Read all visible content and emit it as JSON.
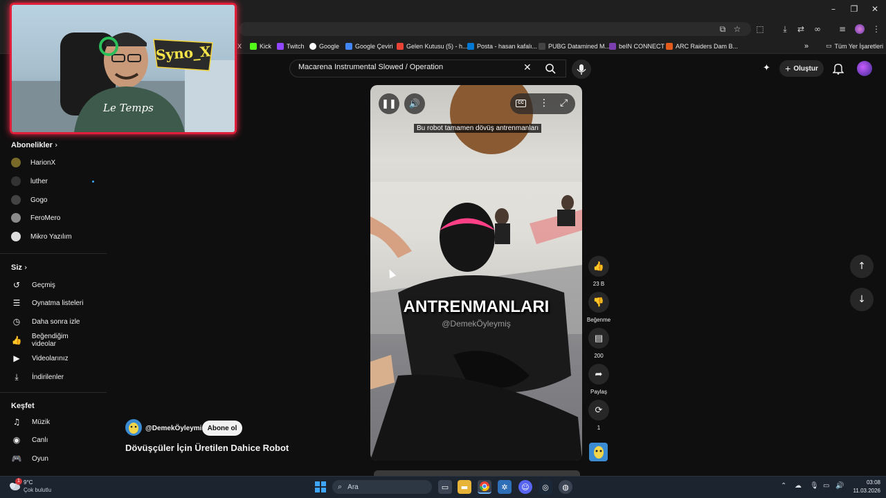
{
  "bookmarks": [
    {
      "label": "X",
      "color": "#000000"
    },
    {
      "label": "Kick",
      "color": "#53fc18"
    },
    {
      "label": "Twitch",
      "color": "#9146ff"
    },
    {
      "label": "Google",
      "color": "#4285f4"
    },
    {
      "label": "Google Çeviri",
      "color": "#4285f4"
    },
    {
      "label": "Gelen Kutusu (5) - h...",
      "color": "#ea4335"
    },
    {
      "label": "Posta - hasan kafalı...",
      "color": "#0078d4"
    },
    {
      "label": "PUBG Datamined M...",
      "color": "#333333"
    },
    {
      "label": "beIN CONNECT",
      "color": "#5b2a86"
    },
    {
      "label": "ARC Raiders Dam B...",
      "color": "#e25a1c"
    }
  ],
  "bookmarks_all": "Tüm Yer İşaretleri",
  "search": {
    "query": "Macarena Instrumental Slowed / Operation"
  },
  "header": {
    "create_label": "Oluştur"
  },
  "webcam": {
    "sign_text": "Syno_X",
    "shirt_text": "Le Temps"
  },
  "sidebar": {
    "subscriptions_title": "Abonelikler",
    "subscriptions": [
      {
        "name": "HarionX",
        "color": "#7a6a2a"
      },
      {
        "name": "luther",
        "color": "#333333"
      },
      {
        "name": "Gogo",
        "color": "#444444"
      },
      {
        "name": "FeroMero",
        "color": "#8a8a8a"
      },
      {
        "name": "Mikro Yazılım",
        "color": "#dddddd"
      }
    ],
    "you_title": "Siz",
    "you_items": [
      {
        "label": "Geçmiş",
        "icon": "history-icon",
        "glyph": "↺"
      },
      {
        "label": "Oynatma listeleri",
        "icon": "playlist-icon",
        "glyph": "☰"
      },
      {
        "label": "Daha sonra izle",
        "icon": "clock-icon",
        "glyph": "◷"
      },
      {
        "label": "Beğendiğim videolar",
        "icon": "thumbs-up-icon",
        "glyph": "👍"
      },
      {
        "label": "Videolarınız",
        "icon": "video-icon",
        "glyph": "▶"
      },
      {
        "label": "İndirilenler",
        "icon": "download-icon",
        "glyph": "⤓"
      }
    ],
    "explore_title": "Keşfet",
    "explore_items": [
      {
        "label": "Müzik",
        "icon": "music-icon",
        "glyph": "♫"
      },
      {
        "label": "Canlı",
        "icon": "live-icon",
        "glyph": "◉"
      },
      {
        "label": "Oyun",
        "icon": "gaming-icon",
        "glyph": "🎮"
      }
    ]
  },
  "video": {
    "caption_top": "Bu robot tamamen dövüş antrenmanları",
    "big_caption": "ANTRENMANLARI",
    "watermark": "@DemekÖyleymiş",
    "channel_name": "@DemekÖyleymiş",
    "subscribe_label": "Abone ol",
    "title": "Dövüşçüler İçin Üretilen Dahice Robot"
  },
  "actions": {
    "likes": "23 B",
    "dislike_label": "Beğenme",
    "comments": "200",
    "share_label": "Paylaş",
    "remix_count": "1"
  },
  "taskbar": {
    "weather_temp": "9°C",
    "weather_desc": "Çok bulutlu",
    "weather_badge": "1",
    "search_placeholder": "Ara",
    "time": "03:08",
    "date": "11.03.2026"
  }
}
